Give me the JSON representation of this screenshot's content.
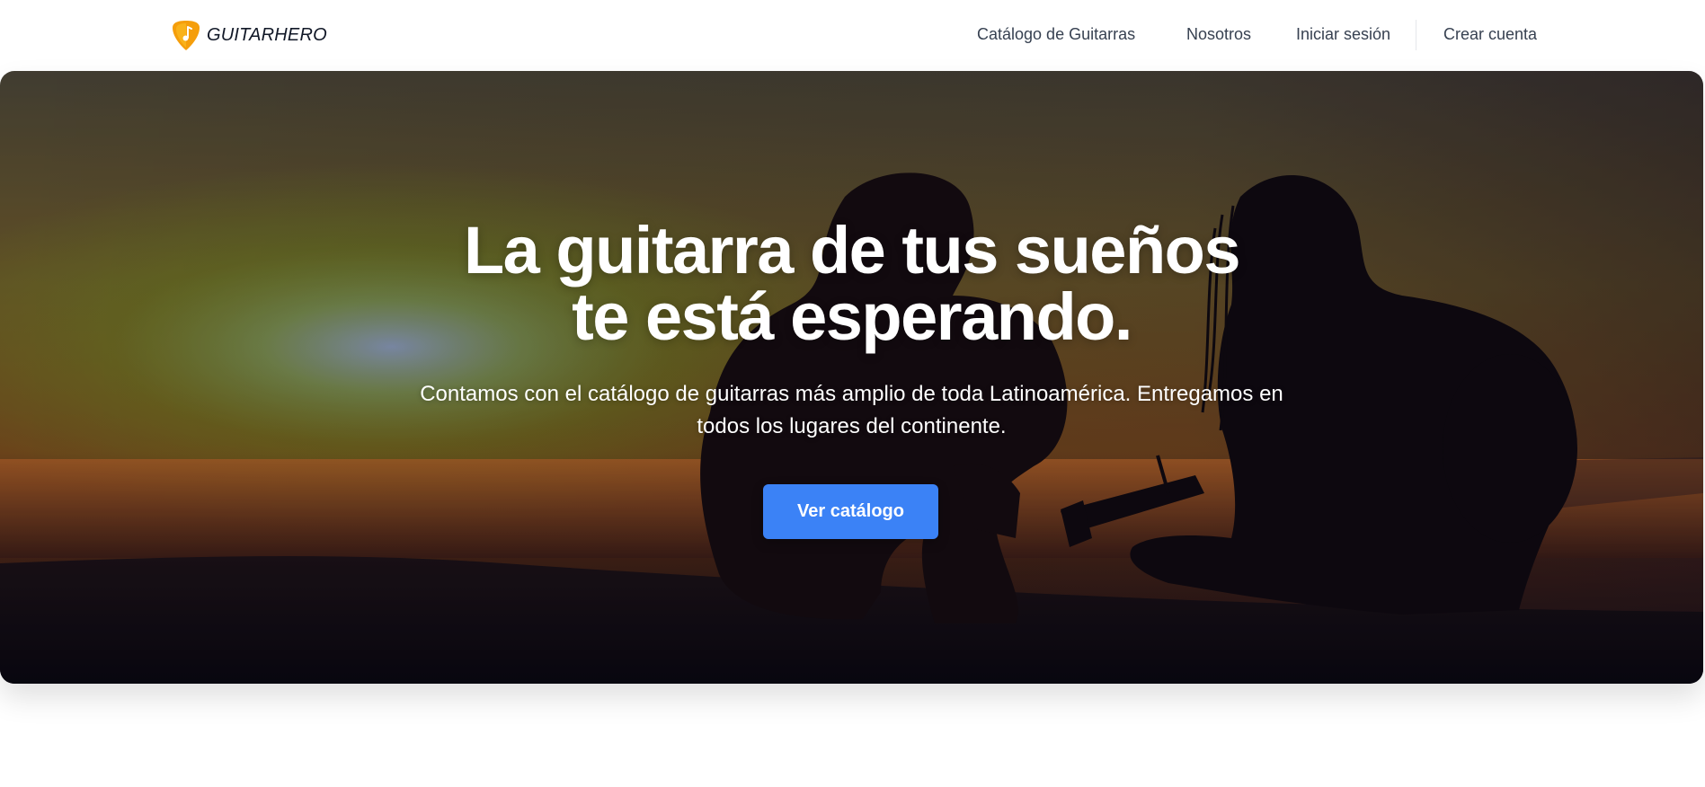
{
  "header": {
    "logo": {
      "icon": "guitar-pick-icon",
      "text": "GUITARHERO",
      "pick_color": "#f59e0b"
    },
    "nav": {
      "catalog": "Catálogo de Guitarras",
      "about": "Nosotros",
      "login": "Iniciar sesión",
      "register": "Crear cuenta"
    }
  },
  "hero": {
    "title_line1": "La guitarra de tus sueños",
    "title_line2": "te está esperando.",
    "subtitle": "Contamos con el catálogo de guitarras más amplio de toda Latinoamérica. Entregamos en todos los lugares del continente.",
    "cta_label": "Ver catálogo",
    "cta_color": "#3b82f6",
    "background": "sunset-silhouette-guitarists"
  }
}
